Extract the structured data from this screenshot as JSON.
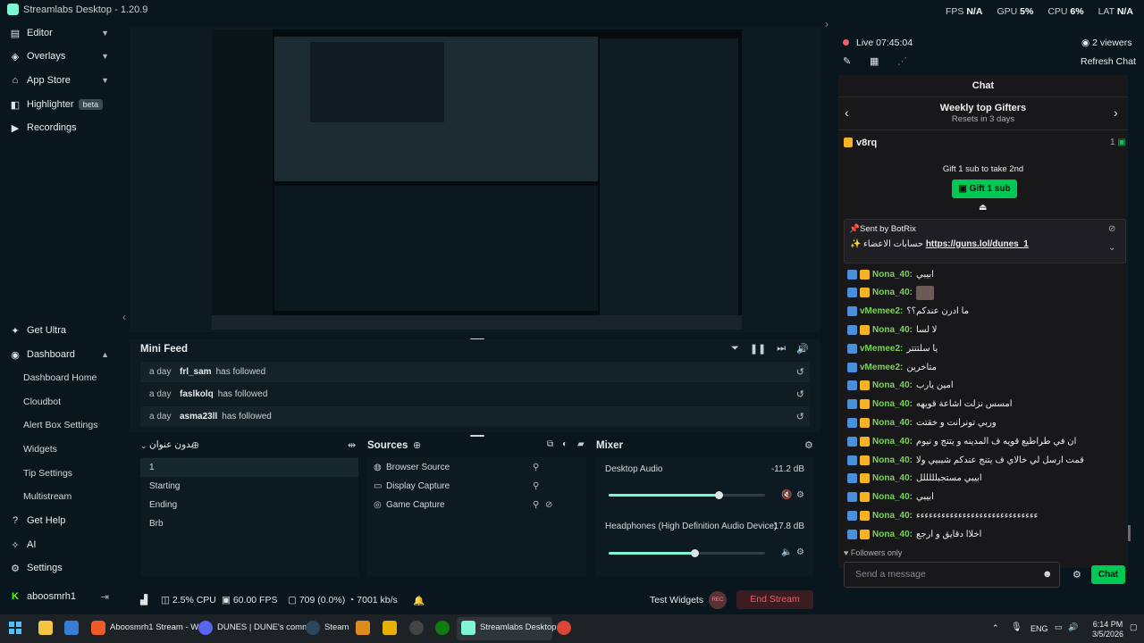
{
  "app": {
    "title": "Streamlabs Desktop - 1.20.9"
  },
  "perf": {
    "fps_label": "FPS",
    "fps": "N/A",
    "gpu_label": "GPU",
    "gpu": "5%",
    "cpu_label": "CPU",
    "cpu": "6%",
    "lat_label": "LAT",
    "lat": "N/A"
  },
  "nav": {
    "editor": "Editor",
    "overlays": "Overlays",
    "app_store": "App Store",
    "highlighter": "Highlighter",
    "beta": "beta",
    "recordings": "Recordings",
    "get_ultra": "Get Ultra",
    "dashboard": "Dashboard",
    "dashboard_home": "Dashboard Home",
    "cloudbot": "Cloudbot",
    "alert_box": "Alert Box Settings",
    "widgets": "Widgets",
    "tip_settings": "Tip Settings",
    "multistream": "Multistream",
    "get_help": "Get Help",
    "ai": "AI",
    "settings": "Settings",
    "user": "aboosmrh1"
  },
  "minifeed": {
    "title": "Mini Feed",
    "rows": [
      {
        "time": "a day",
        "name": "frl_sam",
        "action": "has followed"
      },
      {
        "time": "a day",
        "name": "faslkolq",
        "action": "has followed"
      },
      {
        "time": "a day",
        "name": "asma23ll",
        "action": "has followed"
      }
    ]
  },
  "scenes": {
    "collection": "بدون عنوان",
    "items": [
      "1",
      "Starting",
      "Ending",
      "Brb"
    ]
  },
  "sources": {
    "title": "Sources",
    "items": [
      "Browser Source",
      "Display Capture",
      "Game Capture"
    ]
  },
  "mixer": {
    "title": "Mixer",
    "tracks": [
      {
        "name": "Desktop Audio",
        "db": "-11.2 dB",
        "level": 0.7
      },
      {
        "name": "Headphones (High Definition Audio Device)",
        "db": "-17.8 dB",
        "level": 0.55
      }
    ]
  },
  "status": {
    "cpu": "2.5% CPU",
    "fps": "60.00 FPS",
    "dropped": "709 (0.0%)",
    "bitrate": "7001 kb/s",
    "test_widgets": "Test Widgets",
    "rec": "REC",
    "end_stream": "End Stream"
  },
  "chat": {
    "live": "Live 07:45:04",
    "viewers": "2 viewers",
    "refresh": "Refresh Chat",
    "title": "Chat",
    "gifters_title": "Weekly top Gifters",
    "gifters_sub": "Resets in 3 days",
    "top_user": "v8rq",
    "top_count": "1",
    "gift_line": "Gift  1 sub to take 2nd",
    "gift_button": "Gift 1 sub",
    "pinned_sent": "Sent by  BotRix",
    "pinned_text": "حسابات الاعضاء",
    "pinned_link": "https://guns.lol/dunes_1",
    "messages": [
      {
        "user": "Nona_40:",
        "text": "ابيبي",
        "mod": true
      },
      {
        "user": "Nona_40:",
        "text": "",
        "mod": true
      },
      {
        "user": "vMemee2:",
        "text": "ما ادرن عندكم؟؟",
        "mod": false
      },
      {
        "user": "Nona_40:",
        "text": "لا لسا",
        "mod": true
      },
      {
        "user": "vMemee2:",
        "text": "يا سلتتتر",
        "mod": false
      },
      {
        "user": "vMemee2:",
        "text": "متاخرين",
        "mod": false
      },
      {
        "user": "Nona_40:",
        "text": "امين يارب",
        "mod": true
      },
      {
        "user": "Nona_40:",
        "text": "امسس نزلت اشاعة قويهه",
        "mod": true
      },
      {
        "user": "Nona_40:",
        "text": "وربي تونرانت و خقتت",
        "mod": true
      },
      {
        "user": "Nona_40:",
        "text": "ان في طراطيع قويه ف المدينه و يتنج و نيوم",
        "mod": true
      },
      {
        "user": "Nona_40:",
        "text": "قمت ارسل لي خالاي ف يتنج عندكم شيبيي ولا",
        "mod": true
      },
      {
        "user": "Nona_40:",
        "text": "ابيبي مستجبلللللل",
        "mod": true
      },
      {
        "user": "Nona_40:",
        "text": "ابيبي",
        "mod": true
      },
      {
        "user": "Nona_40:",
        "text": "ءءءءءءءءءءءءءءءءءءءءءءءءءءءءء",
        "mod": true
      },
      {
        "user": "Nona_40:",
        "text": "اخلاا دقايق و ارجع",
        "mod": true
      }
    ],
    "followers_only": "Followers only",
    "input_placeholder": "Send a message",
    "send": "Chat"
  },
  "taskbar": {
    "apps": [
      "Aboosmrh1 Stream - W",
      "DUNES | DUNE's comm",
      "Steam",
      "Streamlabs Desktop"
    ],
    "lang": "ENG",
    "time": "6:14 PM",
    "date": "3/5/2026"
  },
  "colors": {
    "accent": "#80f5d2",
    "danger": "#f85a6a",
    "chat_green": "#00c853"
  }
}
